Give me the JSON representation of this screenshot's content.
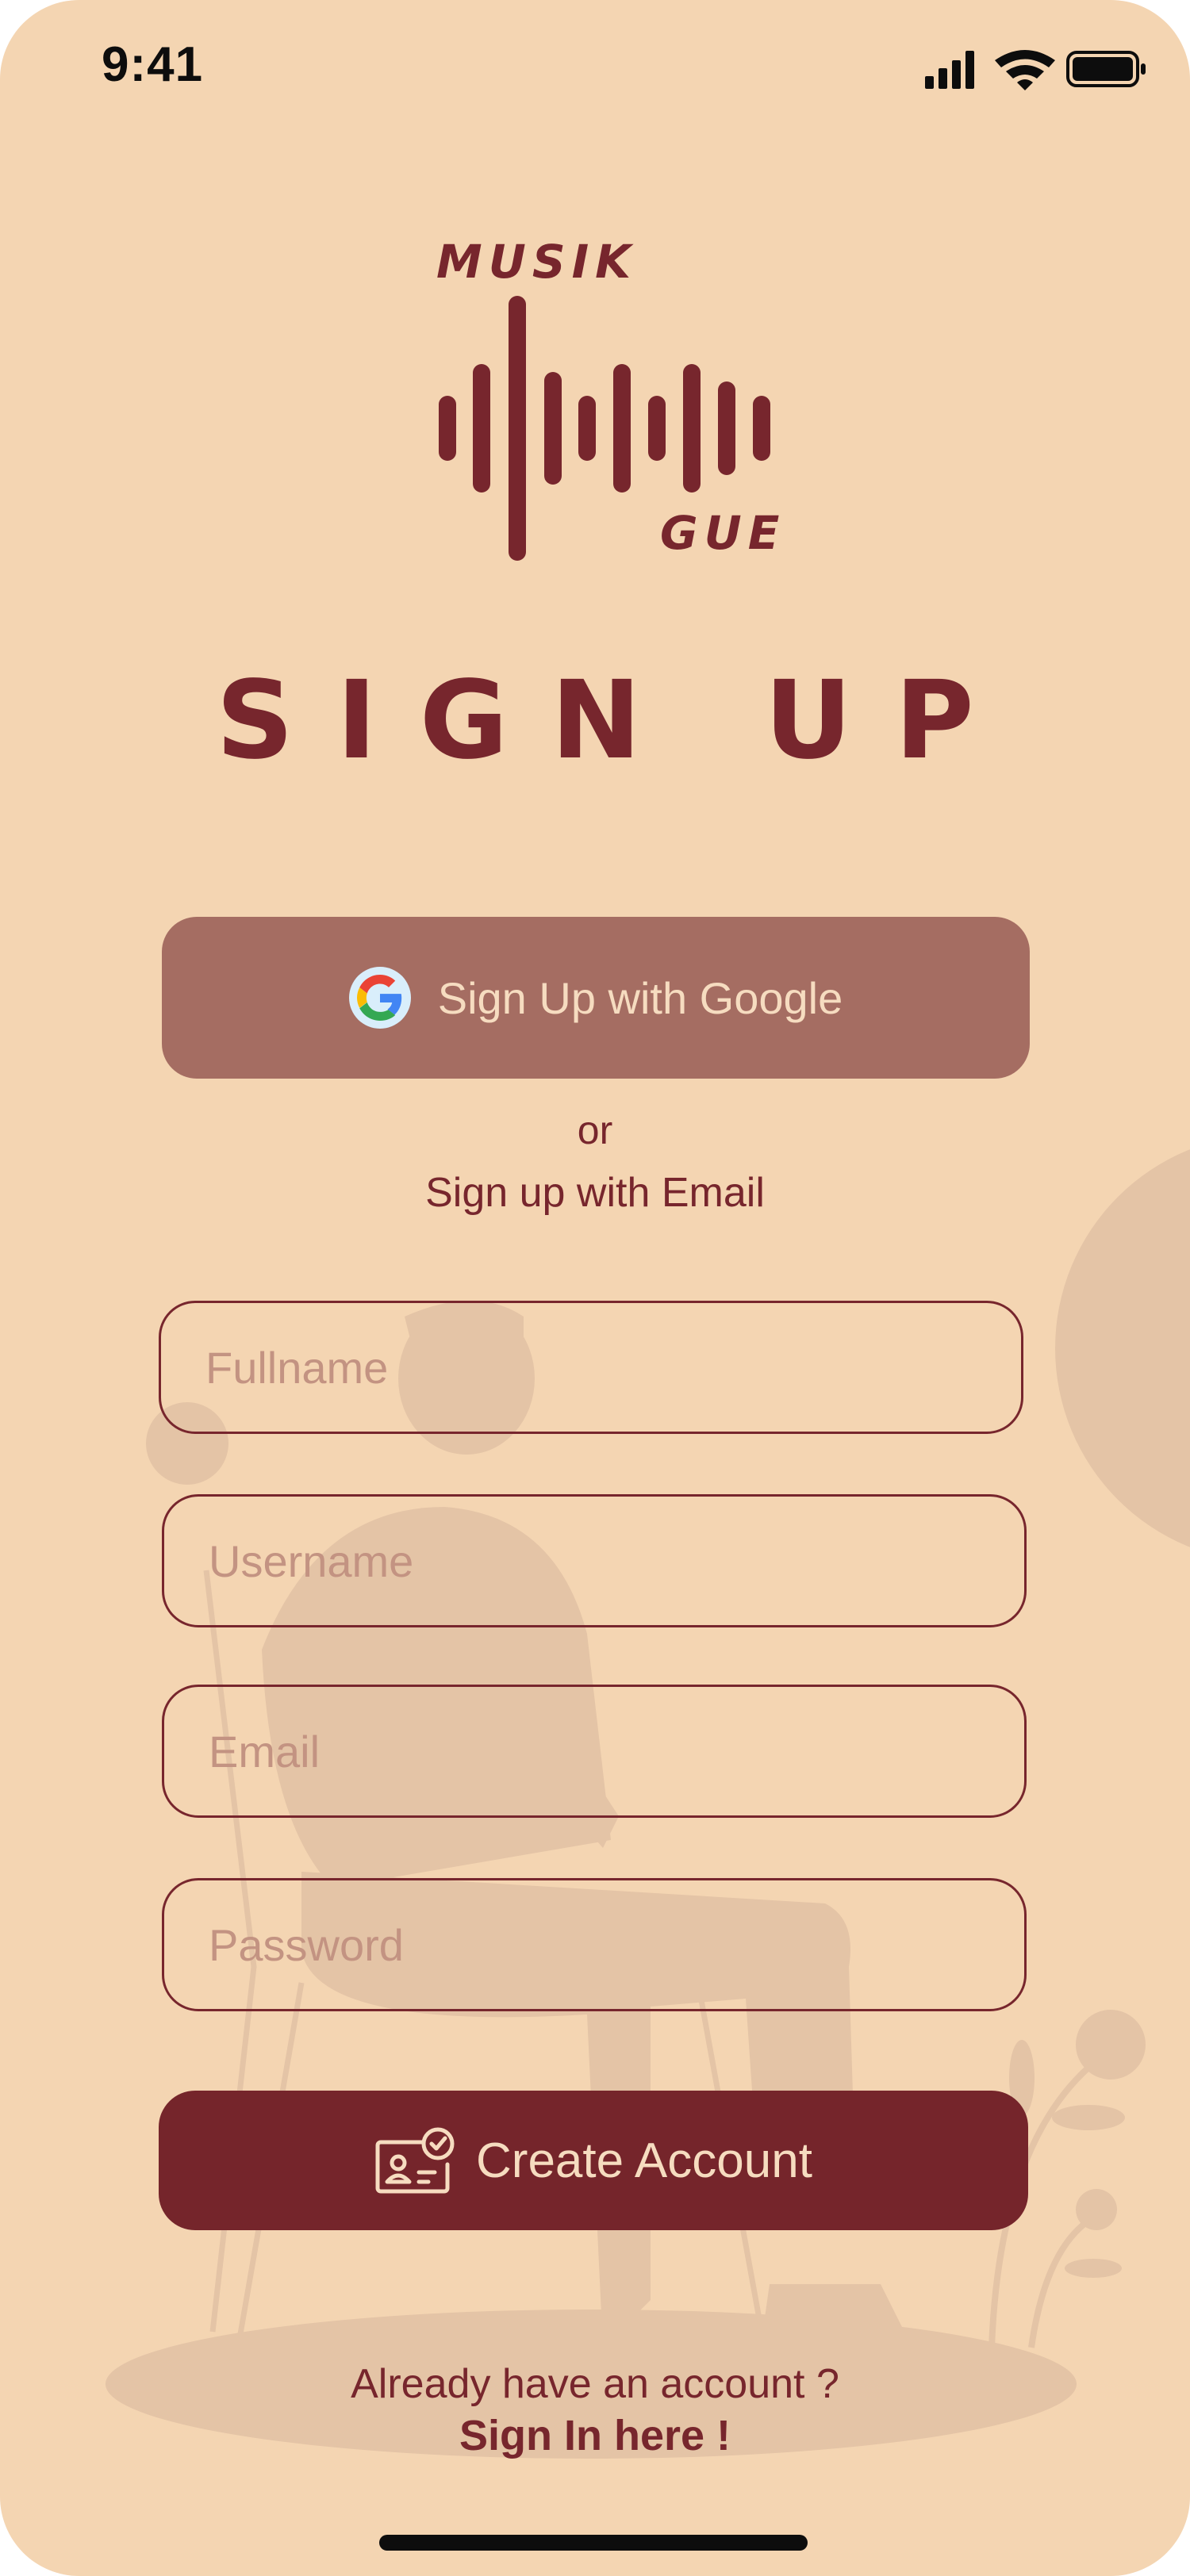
{
  "status_bar": {
    "time": "9:41"
  },
  "logo": {
    "top_word": "MUSIK",
    "bottom_word": "GUE"
  },
  "title": "SIGN UP",
  "google_button": {
    "label": "Sign Up with Google"
  },
  "divider": {
    "or": "or",
    "email_option": "Sign up with Email"
  },
  "form": {
    "fullname_placeholder": "Fullname",
    "username_placeholder": "Username",
    "email_placeholder": "Email",
    "password_placeholder": "Password"
  },
  "create_button": {
    "label": "Create Account"
  },
  "footer": {
    "prompt": "Already have an account ?",
    "signin_link": "Sign In here !"
  },
  "colors": {
    "background": "#f4d5b2",
    "primary": "#77262d",
    "google_button": "#a56d62",
    "button_text": "#f6dcc0",
    "placeholder": "#c39382"
  },
  "icons": [
    "signal-icon",
    "wifi-icon",
    "battery-icon",
    "google-icon",
    "id-card-check-icon"
  ]
}
